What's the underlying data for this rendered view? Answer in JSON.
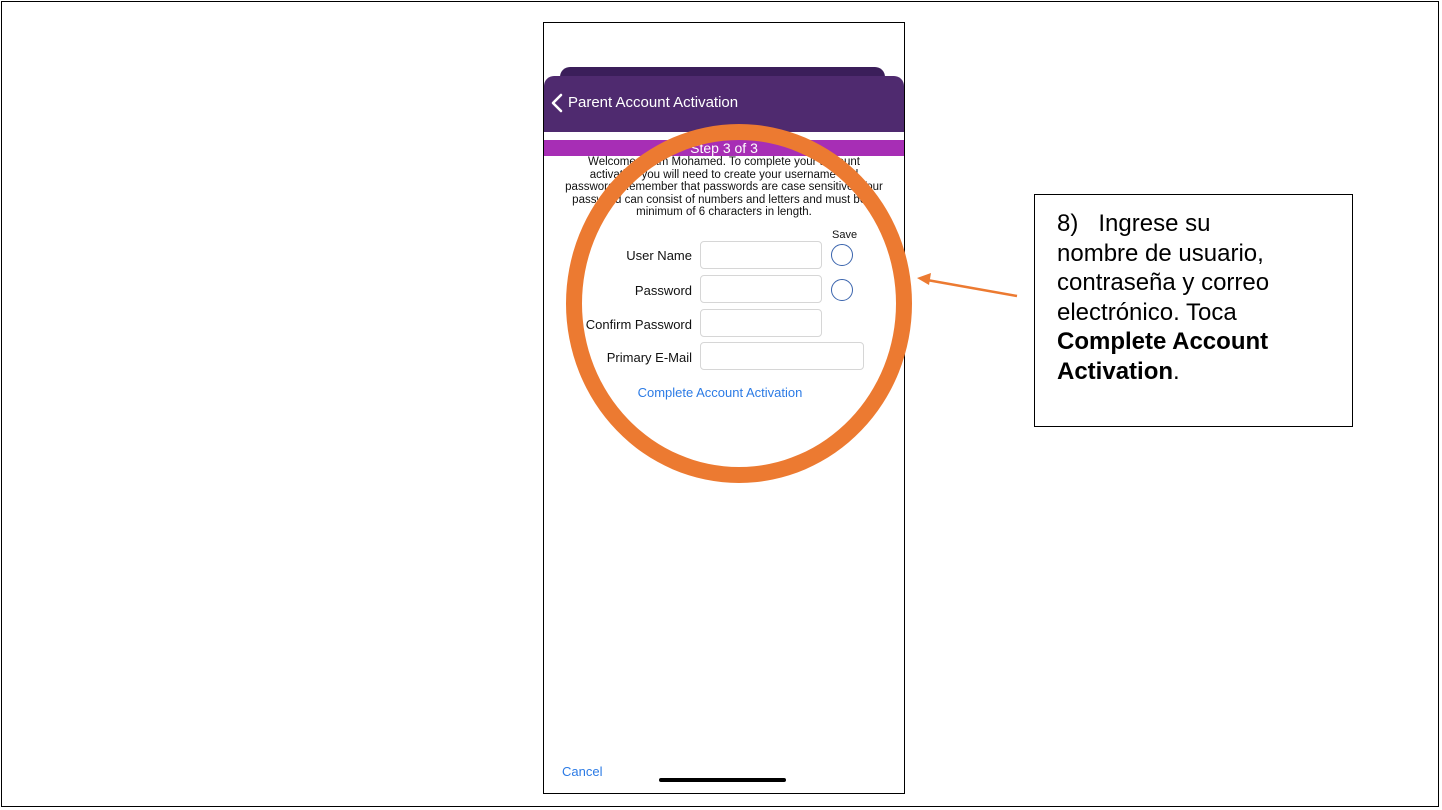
{
  "nav": {
    "title": "Parent Account Activation"
  },
  "step_label": "Step 3 of 3",
  "intro": [
    "Welcome Adam Mohamed. To complete your account",
    "activation you will need to create your username and",
    "password. Remember that passwords are case sensitive. Your",
    "password can consist of numbers and letters and must be a",
    "minimum of 6 characters in length."
  ],
  "save_label": "Save",
  "fields": {
    "user_name": "User Name",
    "password": "Password",
    "confirm_password": "Confirm Password",
    "primary_email": "Primary E-Mail"
  },
  "complete_label": "Complete Account Activation",
  "cancel_label": "Cancel",
  "callout": {
    "number": "8)",
    "text_line_1": "Ingrese su",
    "text_line_2": "nombre de usuario,",
    "text_line_3": "contraseña y correo",
    "text_line_4": "electrónico. Toca",
    "bold_line_1": "Complete Account",
    "bold_line_2": "Activation",
    "end_punct": "."
  },
  "colors": {
    "nav_purple": "#4f2a6f",
    "step_magenta": "#a72eb5",
    "link_blue": "#2c7be5",
    "highlight_orange": "#ec7a31"
  }
}
